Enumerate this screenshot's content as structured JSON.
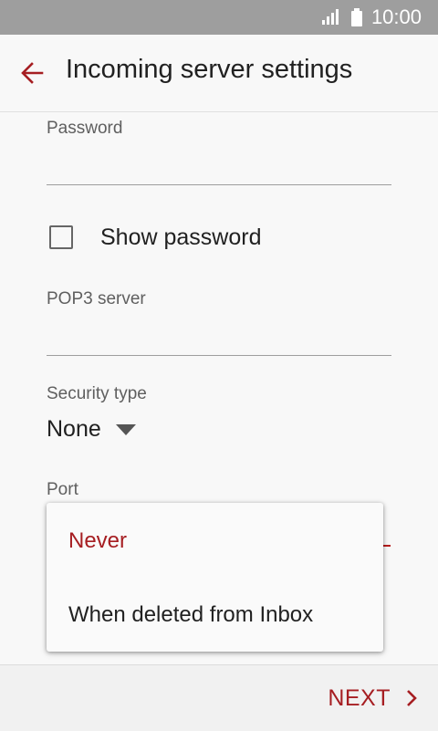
{
  "status_bar": {
    "time": "10:00",
    "signal_icon": "signal-icon",
    "battery_icon": "battery-icon"
  },
  "app_bar": {
    "title": "Incoming server settings",
    "back_icon": "arrow-left-icon"
  },
  "form": {
    "password": {
      "label": "Password",
      "value": ""
    },
    "show_password": {
      "label": "Show password",
      "checked": false
    },
    "pop3_server": {
      "label": "POP3 server",
      "value": ""
    },
    "security_type": {
      "label": "Security type",
      "value": "None"
    },
    "port": {
      "label": "Port"
    }
  },
  "dropdown": {
    "options": [
      {
        "label": "Never",
        "selected": true
      },
      {
        "label": "When deleted from Inbox",
        "selected": false
      }
    ]
  },
  "footer": {
    "next_label": "NEXT",
    "next_icon": "chevron-right-icon"
  },
  "colors": {
    "accent": "#a61e22",
    "status_bar": "#9e9e9e",
    "background": "#f8f8f8"
  }
}
